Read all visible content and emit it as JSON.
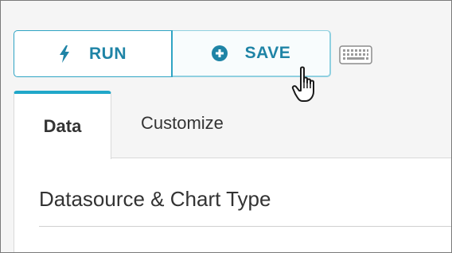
{
  "toolbar": {
    "run_label": "RUN",
    "save_label": "SAVE",
    "run_icon": "bolt-icon",
    "save_icon": "plus-circle-icon",
    "keyboard_icon": "keyboard-icon"
  },
  "tabs": [
    {
      "label": "Data",
      "active": true
    },
    {
      "label": "Customize",
      "active": false
    }
  ],
  "panel": {
    "section_title": "Datasource & Chart Type"
  },
  "colors": {
    "accent": "#20a7c9",
    "button_text": "#1f84a6",
    "background": "#f5f5f5"
  }
}
